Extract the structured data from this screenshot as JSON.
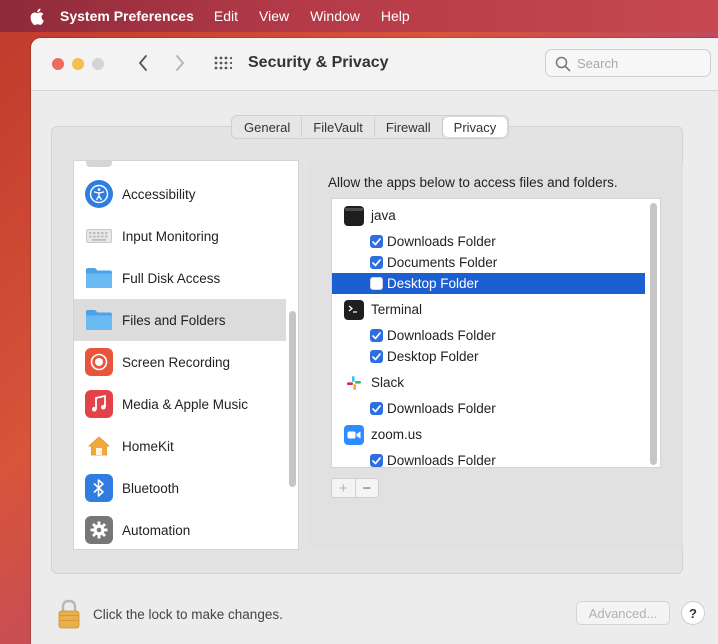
{
  "menubar": {
    "app_name": "System Preferences",
    "items": [
      "Edit",
      "View",
      "Window",
      "Help"
    ]
  },
  "window": {
    "title": "Security & Privacy",
    "search_placeholder": "Search"
  },
  "tabs": [
    {
      "label": "General",
      "active": false
    },
    {
      "label": "FileVault",
      "active": false
    },
    {
      "label": "Firewall",
      "active": false
    },
    {
      "label": "Privacy",
      "active": true
    }
  ],
  "privacy_categories": [
    {
      "label": "Accessibility",
      "icon": "accessibility-icon",
      "color": "#2f7de1",
      "selected": false
    },
    {
      "label": "Input Monitoring",
      "icon": "keyboard-icon",
      "color": "#d9d9d9",
      "selected": false
    },
    {
      "label": "Full Disk Access",
      "icon": "folder-icon",
      "color": "#5aa9e6",
      "selected": false
    },
    {
      "label": "Files and Folders",
      "icon": "folder-icon",
      "color": "#5aa9e6",
      "selected": true
    },
    {
      "label": "Screen Recording",
      "icon": "screen-recording-icon",
      "color": "#e8553a",
      "selected": false
    },
    {
      "label": "Media & Apple Music",
      "icon": "music-icon",
      "color": "#e4414b",
      "selected": false
    },
    {
      "label": "HomeKit",
      "icon": "home-icon",
      "color": "#f2a93b",
      "selected": false
    },
    {
      "label": "Bluetooth",
      "icon": "bluetooth-icon",
      "color": "#2f7de1",
      "selected": false
    },
    {
      "label": "Automation",
      "icon": "gear-icon",
      "color": "#777777",
      "selected": false
    }
  ],
  "files_and_folders": {
    "heading": "Allow the apps below to access files and folders.",
    "apps": [
      {
        "name": "java",
        "icon": "java-icon",
        "folders": [
          {
            "label": "Downloads Folder",
            "checked": true
          },
          {
            "label": "Documents Folder",
            "checked": true
          },
          {
            "label": "Desktop Folder",
            "checked": false,
            "selected": true
          }
        ]
      },
      {
        "name": "Terminal",
        "icon": "terminal-icon",
        "folders": [
          {
            "label": "Downloads Folder",
            "checked": true
          },
          {
            "label": "Desktop Folder",
            "checked": true
          }
        ]
      },
      {
        "name": "Slack",
        "icon": "slack-icon",
        "folders": [
          {
            "label": "Downloads Folder",
            "checked": true
          }
        ]
      },
      {
        "name": "zoom.us",
        "icon": "zoom-icon",
        "folders": [
          {
            "label": "Downloads Folder",
            "checked": true
          }
        ]
      }
    ],
    "add_label": "+",
    "remove_label": "−"
  },
  "footer": {
    "lock_text": "Click the lock to make changes.",
    "advanced_label": "Advanced...",
    "help_label": "?"
  },
  "colors": {
    "selection_blue": "#1c5fd0",
    "checkbox_blue": "#2d6fe0"
  }
}
